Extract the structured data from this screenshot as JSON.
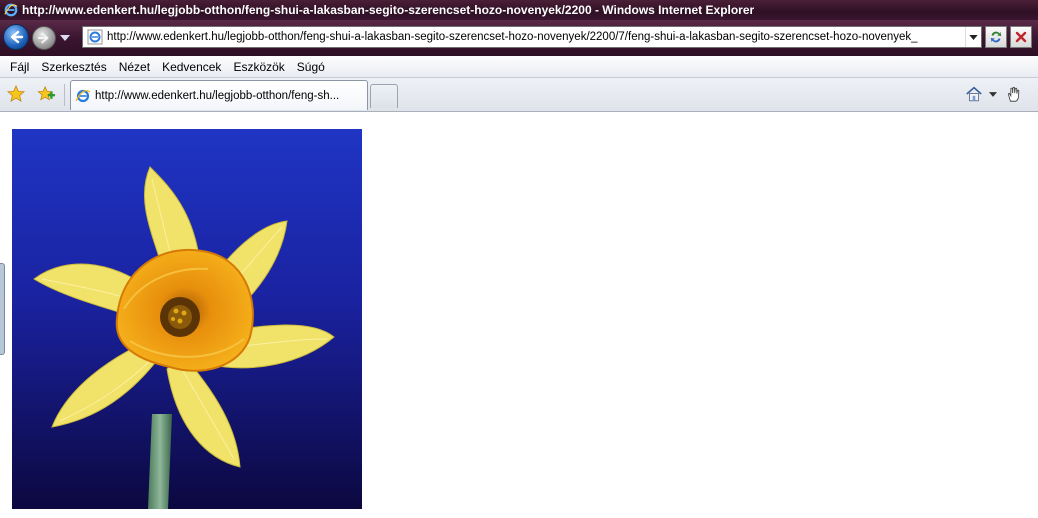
{
  "window": {
    "title": "http://www.edenkert.hu/legjobb-otthon/feng-shui-a-lakasban-segito-szerencset-hozo-novenyek/2200 - Windows Internet Explorer"
  },
  "address_bar": {
    "url": "http://www.edenkert.hu/legjobb-otthon/feng-shui-a-lakasban-segito-szerencset-hozo-novenyek/2200/7/feng-shui-a-lakasban-segito-szerencset-hozo-novenyek_"
  },
  "menu": {
    "items": [
      "Fájl",
      "Szerkesztés",
      "Nézet",
      "Kedvencek",
      "Eszközök",
      "Súgó"
    ]
  },
  "tabs": [
    {
      "label": "http://www.edenkert.hu/legjobb-otthon/feng-sh..."
    }
  ],
  "icons": {
    "back": "back-arrow-icon",
    "forward": "forward-arrow-icon",
    "favorites": "star-icon",
    "add_favorites": "add-favorite-icon",
    "home": "home-icon",
    "research": "hand-icon",
    "refresh": "refresh-icon",
    "stop": "stop-icon"
  },
  "colors": {
    "titlebar": "#2e1024",
    "photo_background": "#1a2aa8",
    "petal": "#f2e36a",
    "trumpet": "#f3a514"
  },
  "content": {
    "image_subject": "daffodil-photo"
  }
}
